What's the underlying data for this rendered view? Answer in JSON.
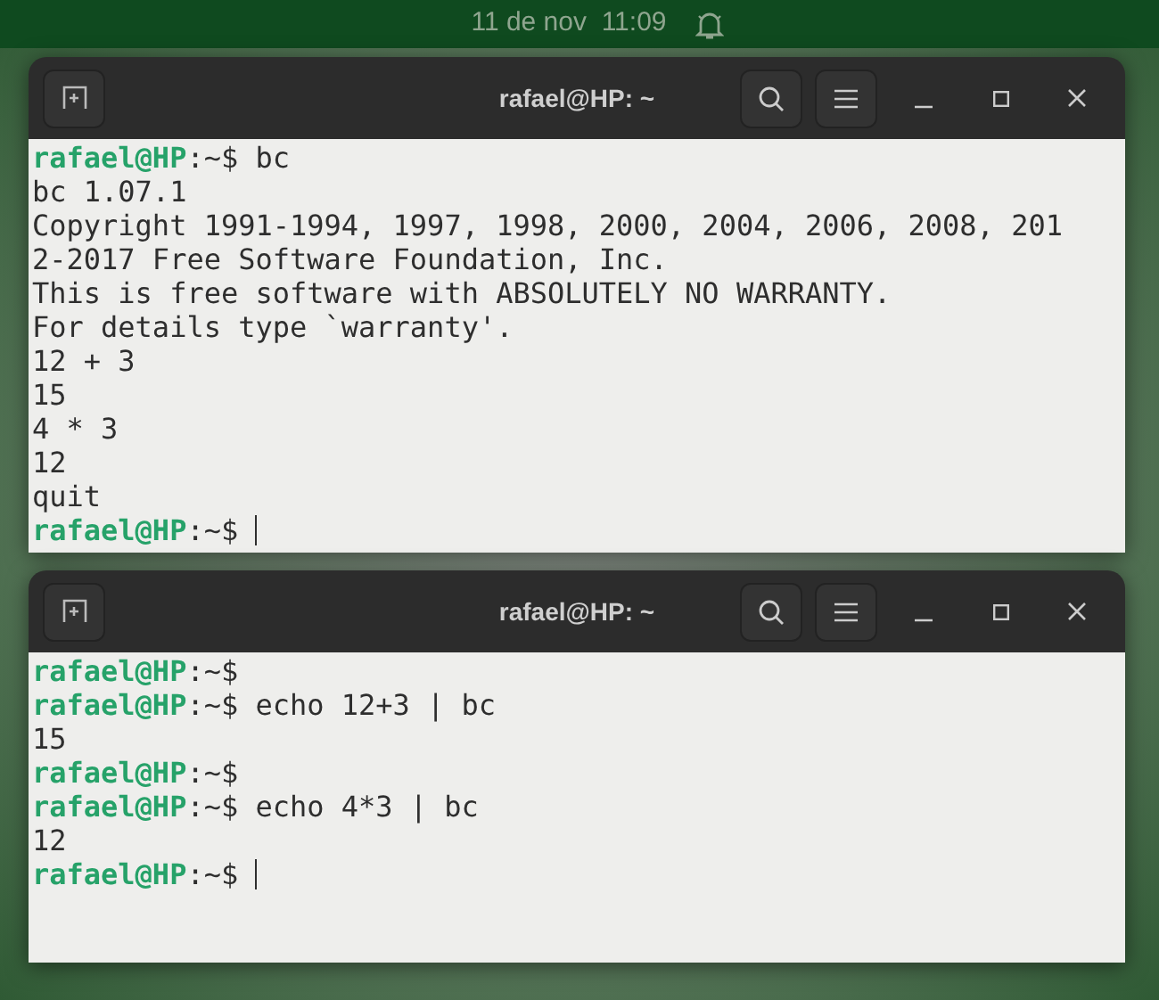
{
  "top_bar": {
    "date": "11 de nov",
    "time": "11:09"
  },
  "terminals": [
    {
      "title": "rafael@HP: ~",
      "lines": [
        {
          "kind": "prompt",
          "user": "rafael@HP",
          "path": ":~$",
          "command": "bc"
        },
        {
          "kind": "output",
          "text": "bc 1.07.1"
        },
        {
          "kind": "output",
          "text": "Copyright 1991-1994, 1997, 1998, 2000, 2004, 2006, 2008, 201"
        },
        {
          "kind": "output",
          "text": "2-2017 Free Software Foundation, Inc."
        },
        {
          "kind": "output",
          "text": "This is free software with ABSOLUTELY NO WARRANTY."
        },
        {
          "kind": "output",
          "text": "For details type `warranty'."
        },
        {
          "kind": "output",
          "text": "12 + 3"
        },
        {
          "kind": "output",
          "text": "15"
        },
        {
          "kind": "output",
          "text": "4 * 3"
        },
        {
          "kind": "output",
          "text": "12"
        },
        {
          "kind": "output",
          "text": "quit"
        },
        {
          "kind": "prompt",
          "user": "rafael@HP",
          "path": ":~$",
          "cursor": true
        }
      ]
    },
    {
      "title": "rafael@HP: ~",
      "lines": [
        {
          "kind": "prompt",
          "user": "rafael@HP",
          "path": ":~$"
        },
        {
          "kind": "prompt",
          "user": "rafael@HP",
          "path": ":~$",
          "command": "echo 12+3 | bc"
        },
        {
          "kind": "output",
          "text": "15"
        },
        {
          "kind": "prompt",
          "user": "rafael@HP",
          "path": ":~$"
        },
        {
          "kind": "prompt",
          "user": "rafael@HP",
          "path": ":~$",
          "command": "echo 4*3 | bc"
        },
        {
          "kind": "output",
          "text": "12"
        },
        {
          "kind": "prompt",
          "user": "rafael@HP",
          "path": ":~$",
          "cursor": true
        }
      ]
    }
  ]
}
